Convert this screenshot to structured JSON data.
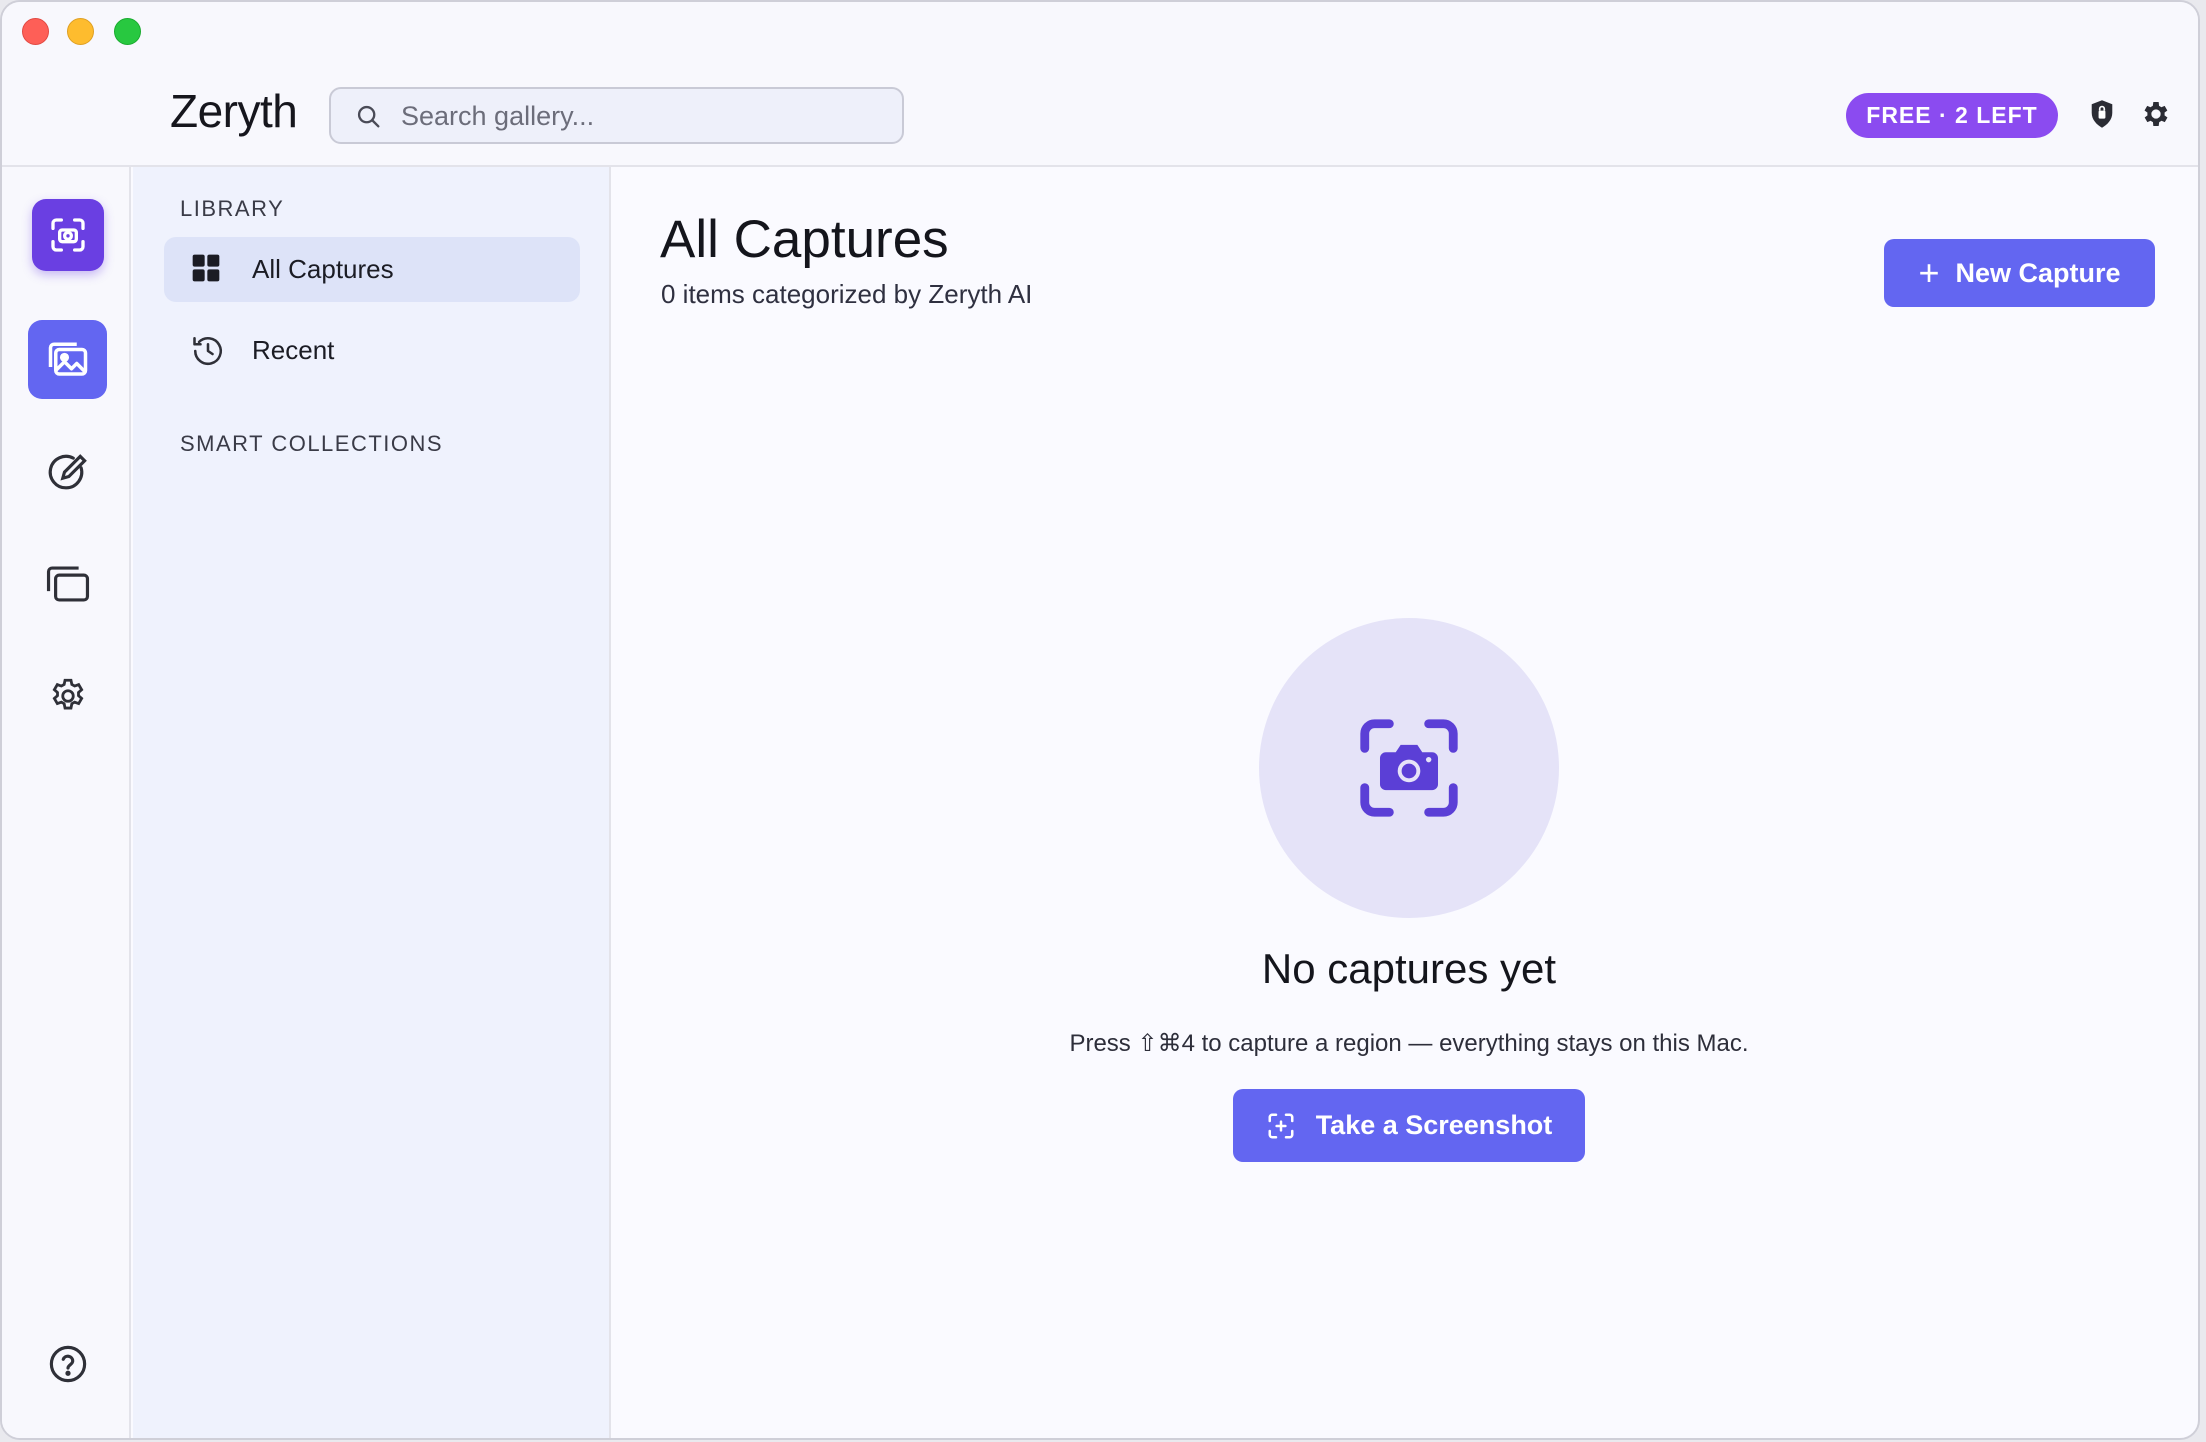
{
  "window": {
    "traffic_lights": [
      "close",
      "minimize",
      "zoom"
    ]
  },
  "header": {
    "app_title": "Zeryth",
    "search_placeholder": "Search gallery...",
    "plan_badge": "FREE · 2 LEFT",
    "icons": [
      "shield-icon",
      "gear-icon"
    ]
  },
  "rail": {
    "items": [
      "capture-icon",
      "gallery-icon",
      "annotate-icon",
      "windows-icon",
      "settings-icon",
      "help-icon"
    ]
  },
  "sidebar": {
    "library_label": "LIBRARY",
    "items": [
      {
        "label": "All Captures",
        "icon": "grid-icon",
        "active": true
      },
      {
        "label": "Recent",
        "icon": "history-icon",
        "active": false
      }
    ],
    "smart_collections_label": "SMART COLLECTIONS"
  },
  "main": {
    "title": "All Captures",
    "subtitle": "0 items categorized by Zeryth AI",
    "new_capture_label": "New Capture",
    "empty": {
      "title": "No captures yet",
      "message": "Press ⇧⌘4 to capture a region — everything stays on this Mac.",
      "button_label": "Take a Screenshot"
    }
  },
  "colors": {
    "accent": "#6366f1",
    "capture_accent": "#6a3fe2",
    "badge": "#8b4bf0",
    "empty_circle": "#e5e3f8"
  }
}
